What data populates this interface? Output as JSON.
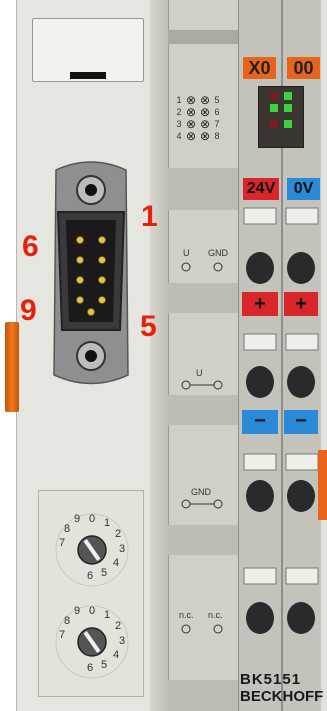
{
  "connector_labels": {
    "pin1": "1",
    "pin6": "6",
    "pin9": "9",
    "pin5": "5"
  },
  "led_matrix": {
    "rows": [
      {
        "left": "1",
        "right": "5"
      },
      {
        "left": "2",
        "right": "6"
      },
      {
        "left": "3",
        "right": "7"
      },
      {
        "left": "4",
        "right": "8"
      }
    ]
  },
  "power_labels": {
    "us_gnd_top_left": "U",
    "us_gnd_top_right": "GND",
    "us_mid": "U",
    "gnd_mid": "GND",
    "nc_left": "n.c.",
    "nc_right": "n.c."
  },
  "header_tags": {
    "x0": "X0",
    "oo": "00"
  },
  "supply_tags": {
    "v24": "24V",
    "v0": "0V"
  },
  "polarity": {
    "plus": "+",
    "minus": "−"
  },
  "model": {
    "name": "BK5151",
    "brand": "BECKHOFF"
  },
  "colors": {
    "housing": "#e9e9e3",
    "side_panel": "#c9cac3",
    "orange_tag": "#e8641a",
    "red_tag": "#d9262b",
    "blue_tag": "#2b8ad7",
    "green_led": "#3bd43b",
    "red_text": "#e8200a"
  }
}
